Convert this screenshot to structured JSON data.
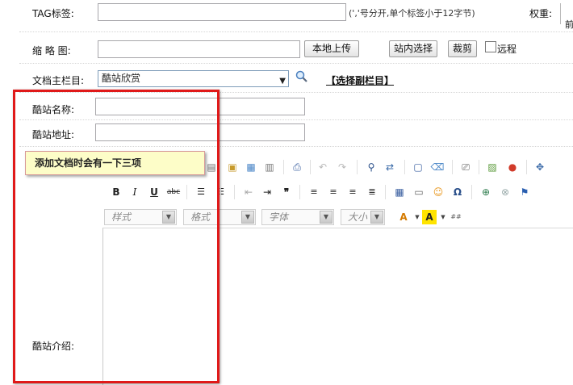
{
  "form": {
    "tag_label": "TAG标签:",
    "tag_value": "",
    "tag_hint": "(','号分开,单个标签小于12字节)",
    "weight_label": "权重:",
    "edge_text": "前",
    "thumb_label": "缩 略 图:",
    "thumb_value": "",
    "upload_btn": "本地上传",
    "site_select_btn": "站内选择",
    "crop_btn": "裁剪",
    "remote_label": "远程",
    "main_col_label": "文档主栏目:",
    "main_col_value": "酷站欣赏",
    "sub_col_link": "【选择副栏目】",
    "site_name_label": "酷站名称:",
    "site_name_value": "",
    "site_url_label": "酷站地址:",
    "site_url_value": "",
    "site_intro_label": "酷站介绍:"
  },
  "callout": {
    "text": "添加文档时会有一下三项"
  },
  "editor": {
    "combos": {
      "style": "样式",
      "format": "格式",
      "font": "字体",
      "size": "大小"
    },
    "buttons": {
      "bold": "B",
      "italic": "I",
      "underline": "U",
      "strike": "abc",
      "omega": "Ω",
      "find": "🔍"
    }
  },
  "colors": {
    "annotation_border": "#e01919",
    "callout_bg": "#fdfdc8"
  }
}
